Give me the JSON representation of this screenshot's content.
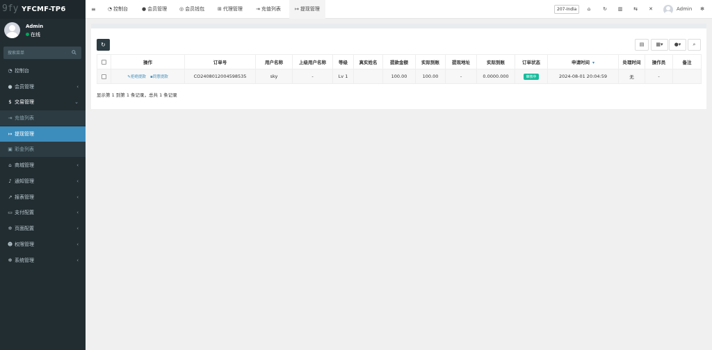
{
  "app": {
    "watermark": "9fy",
    "brand": "YFCMF-TP6"
  },
  "user": {
    "name": "Admin",
    "status": "在线"
  },
  "search": {
    "placeholder": "搜索菜单"
  },
  "sidebar": {
    "items": [
      {
        "label": "控制台",
        "icon": "dashboard-icon"
      },
      {
        "label": "会员管理",
        "icon": "user-icon",
        "chevron": "‹"
      },
      {
        "label": "交易管理",
        "icon": "money-icon",
        "chevron": "⌄"
      },
      {
        "label": "充值列表",
        "icon": "sign-in-icon"
      },
      {
        "label": "提现管理",
        "icon": "sign-out-icon"
      },
      {
        "label": "彩金列表",
        "icon": "gift-icon"
      },
      {
        "label": "商城管理",
        "icon": "home-icon",
        "chevron": "‹"
      },
      {
        "label": "通知管理",
        "icon": "bell-icon",
        "chevron": "‹"
      },
      {
        "label": "报表管理",
        "icon": "chart-icon",
        "chevron": "‹"
      },
      {
        "label": "支付配置",
        "icon": "credit-card-icon",
        "chevron": "‹"
      },
      {
        "label": "页面配置",
        "icon": "gear-icon",
        "chevron": "‹"
      },
      {
        "label": "权限管理",
        "icon": "users-icon",
        "chevron": "‹"
      },
      {
        "label": "系统管理",
        "icon": "cogs-icon",
        "chevron": "‹"
      }
    ]
  },
  "topbar": {
    "tabs": [
      {
        "label": "控制台",
        "icon": "dashboard-icon"
      },
      {
        "label": "会员管理",
        "icon": "user-icon"
      },
      {
        "label": "会员钱包",
        "icon": "wallet-icon"
      },
      {
        "label": "代理管理",
        "icon": "sitemap-icon"
      },
      {
        "label": "充值列表",
        "icon": "sign-in-icon"
      },
      {
        "label": "提现管理",
        "icon": "sign-out-icon"
      }
    ],
    "region": "207-India",
    "user": "Admin"
  },
  "table": {
    "columns": [
      "操作",
      "订单号",
      "用户名称",
      "上级用户名称",
      "等级",
      "真实姓名",
      "提款金额",
      "实际到账",
      "提现地址",
      "实际到账",
      "订单状态",
      "申请时间",
      "处理时间",
      "操作员",
      "备注"
    ],
    "rows": [
      {
        "actions": [
          "拒绝提款",
          "同意提款"
        ],
        "order_no": "CO2408012004598535",
        "username": "sky",
        "parent_username": "-",
        "level": "Lv 1",
        "real_name": "",
        "amount": "100.00",
        "actual_received": "100.00",
        "address": "-",
        "actual_received_2": "0.0000.000",
        "status": "审核中",
        "apply_time": "2024-08-01 20:04:59",
        "process_time": "无",
        "operator": "-",
        "remark": ""
      }
    ]
  },
  "pagination": {
    "info": "显示第 1 到第 1 条记录，总共 1 条记录"
  },
  "colors": {
    "sidebar": "#222d32",
    "active": "#3c8dbc",
    "badge": "#18bc9c"
  }
}
